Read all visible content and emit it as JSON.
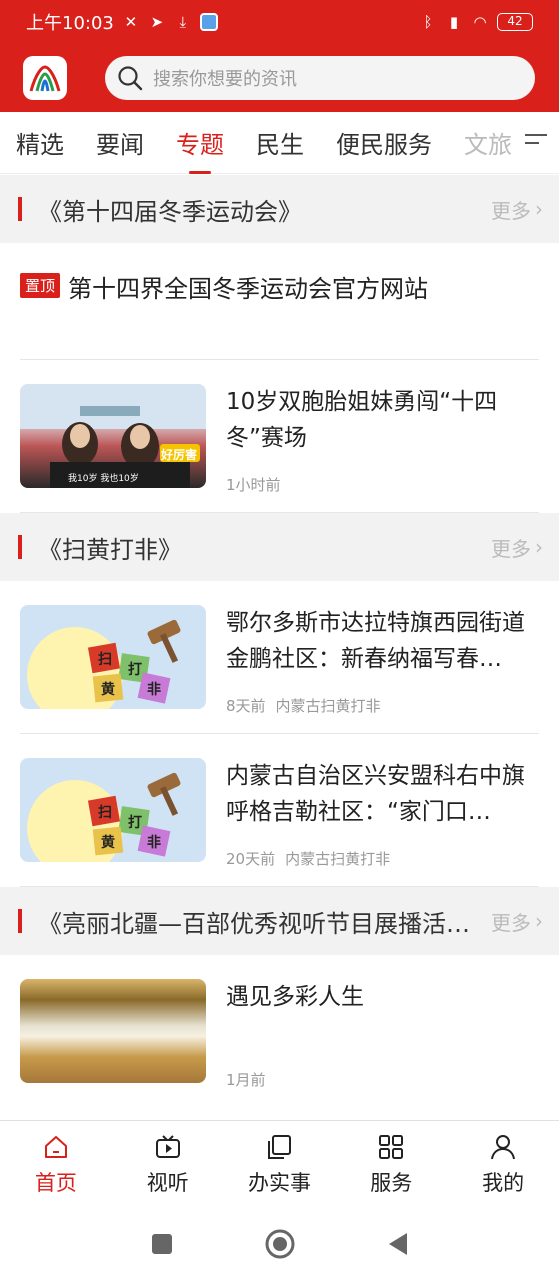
{
  "status": {
    "time": "上午10:03",
    "battery": "42"
  },
  "search": {
    "placeholder": "搜索你想要的资讯"
  },
  "tabs": [
    {
      "label": "精选"
    },
    {
      "label": "要闻"
    },
    {
      "label": "专题"
    },
    {
      "label": "民生"
    },
    {
      "label": "便民服务"
    },
    {
      "label": "文旅"
    }
  ],
  "sections": [
    {
      "title": "《第十四届冬季运动会》",
      "more": "更多",
      "top_item": {
        "tag": "置顶",
        "title": "第十四界全国冬季运动会官方网站"
      },
      "items": [
        {
          "title": "10岁双胞胎姐妹勇闯“十四冬”赛场",
          "time": "1小时前",
          "source": "",
          "thumb_caption": "我10岁  我也10岁",
          "thumb_badge": "好厉害"
        }
      ]
    },
    {
      "title": "《扫黄打非》",
      "more": "更多",
      "items": [
        {
          "title": "鄂尔多斯市达拉特旗西园街道金鹏社区：新春纳福写春…",
          "time": "8天前",
          "source": "内蒙古扫黄打非",
          "thumb_words": [
            "扫",
            "黄",
            "打",
            "非"
          ]
        },
        {
          "title": "内蒙古自治区兴安盟科右中旗呼格吉勒社区：“家门口…",
          "time": "20天前",
          "source": "内蒙古扫黄打非",
          "thumb_words": [
            "扫",
            "黄",
            "打",
            "非"
          ]
        }
      ]
    },
    {
      "title": "《亮丽北疆—百部优秀视听节目展播活…",
      "more": "更多",
      "items": [
        {
          "title": "遇见多彩人生",
          "time": "1月前",
          "source": ""
        }
      ]
    }
  ],
  "bottom_nav": [
    {
      "label": "首页",
      "icon": "home-icon",
      "active": true
    },
    {
      "label": "视听",
      "icon": "video-icon",
      "active": false
    },
    {
      "label": "办实事",
      "icon": "copy-icon",
      "active": false
    },
    {
      "label": "服务",
      "icon": "grid-icon",
      "active": false
    },
    {
      "label": "我的",
      "icon": "person-icon",
      "active": false
    }
  ],
  "colors": {
    "accent": "#d9201b"
  }
}
